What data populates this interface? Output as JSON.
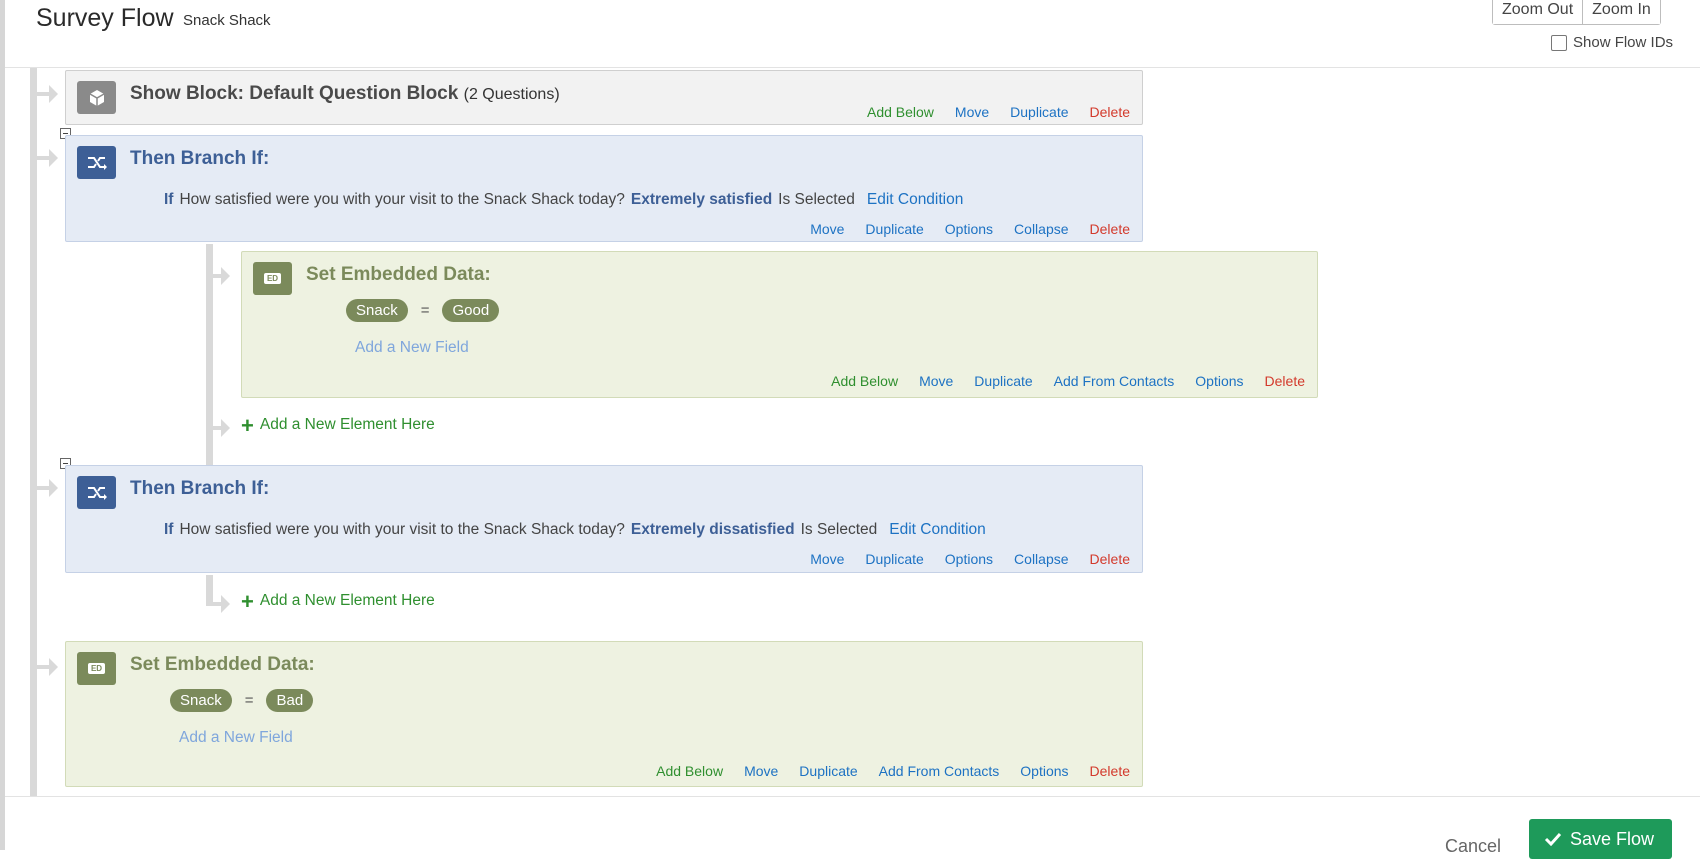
{
  "header": {
    "title": "Survey Flow",
    "subtitle": "Snack Shack",
    "zoom_out": "Zoom Out",
    "zoom_in": "Zoom In",
    "show_flow_ids": "Show Flow IDs",
    "show_flow_ids_checked": false
  },
  "flow": {
    "block1": {
      "title": "Show Block: Default Question Block",
      "count": "(2 Questions)",
      "actions": [
        "Add Below",
        "Move",
        "Duplicate",
        "Delete"
      ]
    },
    "branch1": {
      "title": "Then Branch If:",
      "if": "If",
      "question": "How satisfied were you with your visit to the Snack Shack today?",
      "answer": "Extremely satisfied",
      "operator": "Is Selected",
      "edit": "Edit Condition",
      "actions": [
        "Move",
        "Duplicate",
        "Options",
        "Collapse",
        "Delete"
      ]
    },
    "embedded1": {
      "title": "Set Embedded Data:",
      "field": "Snack",
      "eq": "=",
      "value": "Good",
      "add_field": "Add a New Field",
      "actions": [
        "Add Below",
        "Move",
        "Duplicate",
        "Add From Contacts",
        "Options",
        "Delete"
      ]
    },
    "add_element_1": "Add a New Element Here",
    "branch2": {
      "title": "Then Branch If:",
      "if": "If",
      "question": "How satisfied were you with your visit to the Snack Shack today?",
      "answer": "Extremely dissatisfied",
      "operator": "Is Selected",
      "edit": "Edit Condition",
      "actions": [
        "Move",
        "Duplicate",
        "Options",
        "Collapse",
        "Delete"
      ]
    },
    "add_element_2": "Add a New Element Here",
    "embedded2": {
      "title": "Set Embedded Data:",
      "field": "Snack",
      "eq": "=",
      "value": "Bad",
      "add_field": "Add a New Field",
      "actions": [
        "Add Below",
        "Move",
        "Duplicate",
        "Add From Contacts",
        "Options",
        "Delete"
      ]
    }
  },
  "footer": {
    "cancel": "Cancel",
    "save": "Save Flow"
  },
  "colors": {
    "block_gray": "#f2f2f2",
    "branch_blue": "#3d5f96",
    "embedded_green": "#7b8a5b",
    "link_blue": "#1d72c3",
    "action_green": "#2f8f2f",
    "delete_red": "#d33a2c",
    "save_green": "#1e9a5a"
  }
}
